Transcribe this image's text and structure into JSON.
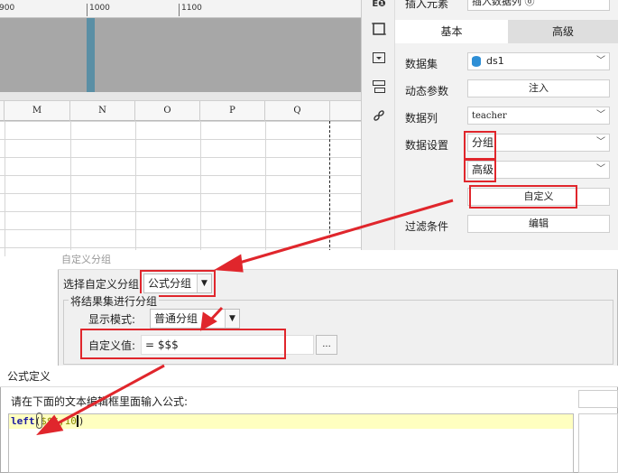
{
  "ruler": {
    "ticks": [
      "900",
      "1000",
      "1100"
    ]
  },
  "grid": {
    "columns": [
      "M",
      "N",
      "O",
      "P",
      "Q"
    ]
  },
  "toolbar": {
    "icons": [
      "info-chart-icon",
      "square-icon",
      "frame-icon",
      "layout-icon",
      "link-icon"
    ]
  },
  "panel": {
    "top_label": "插入元素",
    "top_value": "插入数据列 ⓓ",
    "tabs": {
      "basic": "基本",
      "advanced": "高级"
    },
    "dataset_label": "数据集",
    "dataset_value": "ds1",
    "dynamic_param_label": "动态参数",
    "inject_button": "注入",
    "data_column_label": "数据列",
    "data_column_value": "teacher",
    "data_setting_label": "数据设置",
    "group_value": "分组",
    "advanced_value": "高级",
    "custom_button": "自定义",
    "filter_label": "过滤条件",
    "edit_button": "编辑"
  },
  "dialog_group": {
    "title": "自定义分组",
    "choose_label": "选择自定义分组",
    "choose_value": "公式分组",
    "section_label": "将结果集进行分组",
    "display_mode_label": "显示模式:",
    "display_mode_value": "普通分组",
    "custom_value_label": "自定义值:",
    "custom_value": "= $$$",
    "more_button": "..."
  },
  "dialog_formula": {
    "title": "公式定义",
    "instruction": "请在下面的文本编辑框里面输入公式:",
    "code_func": "left",
    "code_paren": "(",
    "code_arg": "$$$",
    "code_rest": ",10",
    "code_close": ")"
  },
  "colors": {
    "accent_red": "#e0262c",
    "code_highlight": "#ffffc0",
    "code_keyword": "#1a1aa0",
    "code_arg": "#8a8a00"
  }
}
